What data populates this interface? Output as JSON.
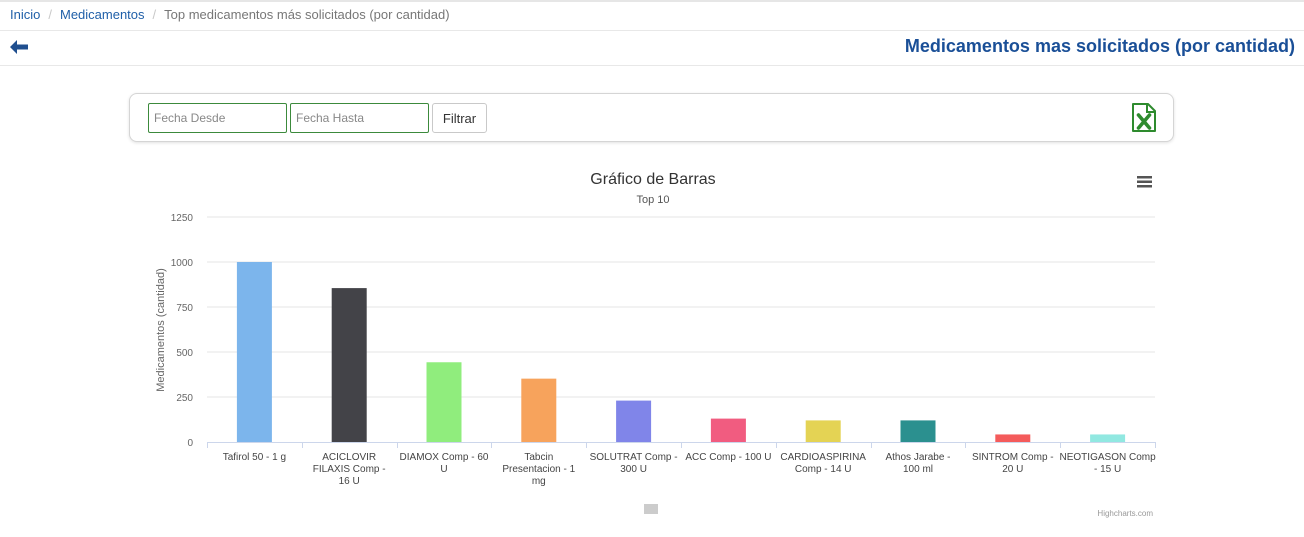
{
  "breadcrumb": {
    "home": "Inicio",
    "section": "Medicamentos",
    "current": "Top medicamentos más solicitados (por cantidad)"
  },
  "header": {
    "title": "Medicamentos mas solicitados (por cantidad)"
  },
  "filters": {
    "desde_placeholder": "Fecha Desde",
    "hasta_placeholder": "Fecha Hasta",
    "submit_label": "Filtrar"
  },
  "icons": {
    "back": "arrow-left-icon",
    "export": "excel-icon",
    "menu": "hamburger-menu-icon"
  },
  "colors": {
    "link": "#1f5fa8",
    "title": "#1a4f97",
    "excel": "#2e8b2e"
  },
  "chart_data": {
    "type": "bar",
    "title": "Gráfico de Barras",
    "subtitle": "Top 10",
    "ylabel": "Medicamentos (cantidad)",
    "ylim": [
      0,
      1250
    ],
    "yticks": [
      0,
      250,
      500,
      750,
      1000,
      1250
    ],
    "grid": true,
    "credit": "Highcharts.com",
    "categories": [
      "Tafirol 50 - 1 g",
      "ACICLOVIR FILAXIS Comp - 16 U",
      "DIAMOX Comp - 60 U",
      "Tabcin Presentacion - 1 mg",
      "SOLUTRAT Comp - 300 U",
      "ACC Comp - 100 U",
      "CARDIOASPIRINA Comp - 14 U",
      "Athos Jarabe - 100 ml",
      "SINTROM Comp - 20 U",
      "NEOTIGASON Comp - 15 U"
    ],
    "values": [
      1000,
      855,
      443,
      352,
      230,
      130,
      120,
      120,
      42,
      42
    ],
    "colors": [
      "#7cb5ec",
      "#434348",
      "#90ed7d",
      "#f7a35c",
      "#8085e9",
      "#f15c80",
      "#e4d354",
      "#2b908f",
      "#f45b5b",
      "#91e8e1"
    ]
  }
}
